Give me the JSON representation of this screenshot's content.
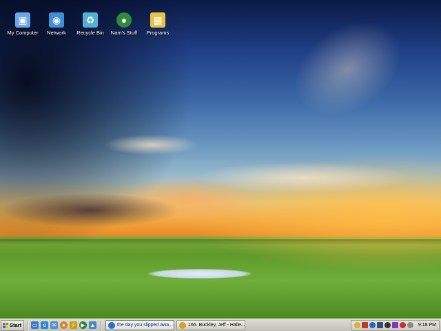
{
  "desktop": {
    "icons": [
      {
        "label": "My Computer",
        "icon": "my-computer-icon",
        "color": "#6aa6e8"
      },
      {
        "label": "Network",
        "icon": "network-icon",
        "color": "#3f8fd8"
      },
      {
        "label": "Recycle Bin",
        "icon": "recycle-bin-icon",
        "color": "#54b0d0"
      },
      {
        "label": "Nam's Stuff",
        "icon": "globe-icon",
        "color": "#2f8a3e"
      },
      {
        "label": "Programs",
        "icon": "programs-folder-icon",
        "color": "#e8c242"
      }
    ]
  },
  "taskbar": {
    "start_label": "Start",
    "quick_launch": [
      {
        "icon": "show-desktop-icon",
        "color": "#3d79c9"
      },
      {
        "icon": "internet-explorer-icon",
        "color": "#2d86d4"
      },
      {
        "icon": "mail-icon",
        "color": "#4e8ed0"
      },
      {
        "icon": "firefox-icon",
        "color": "#d9802c"
      },
      {
        "icon": "winamp-icon",
        "color": "#c99a20"
      },
      {
        "icon": "media-player-icon",
        "color": "#2e7c3a"
      },
      {
        "icon": "paint-icon",
        "color": "#4a86c4"
      }
    ],
    "tasks": [
      {
        "label": "the day you slipped awa...",
        "icon": "messenger-icon",
        "color": "#2c6ed2",
        "active": true
      },
      {
        "label": "166. Buckley, Jeff - Halle...",
        "icon": "winamp-icon",
        "color": "#d7a02c",
        "active": false
      }
    ],
    "tray_icons": [
      {
        "icon": "tray-chrome-icon",
        "color": "#d8b23a"
      },
      {
        "icon": "tray-shield-icon",
        "color": "#c03a2a"
      },
      {
        "icon": "tray-messenger-icon",
        "color": "#2266cc"
      },
      {
        "icon": "tray-network-icon",
        "color": "#3a4a78"
      },
      {
        "icon": "tray-panda-icon",
        "color": "#333333"
      },
      {
        "icon": "tray-volume-icon",
        "color": "#7a3ac0"
      },
      {
        "icon": "tray-security-icon",
        "color": "#c03030"
      },
      {
        "icon": "tray-update-icon",
        "color": "#8a8a8a"
      }
    ],
    "clock": "9:18 PM"
  }
}
